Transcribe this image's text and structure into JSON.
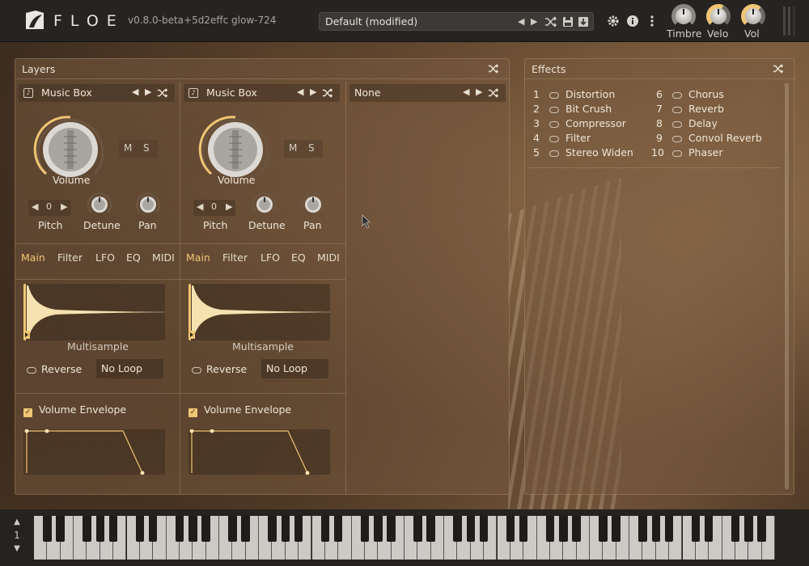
{
  "app": {
    "name": "FLOE",
    "version": "v0.8.0-beta+5d2effc  glow-724"
  },
  "preset": {
    "name": "Default (modified)"
  },
  "top_knobs": [
    {
      "label": "Timbre",
      "value": 0.5
    },
    {
      "label": "Velo",
      "value": 0.55
    },
    {
      "label": "Vol",
      "value": 0.6
    }
  ],
  "layers_panel": {
    "title": "Layers"
  },
  "layers": [
    {
      "instrument": "Music Box",
      "volume_label": "Volume",
      "mute": "M",
      "solo": "S",
      "pitch_value": "0",
      "pitch_label": "Pitch",
      "detune_label": "Detune",
      "pan_label": "Pan",
      "tabs": [
        "Main",
        "Filter",
        "LFO",
        "EQ",
        "MIDI"
      ],
      "active_tab": "Main",
      "sample_label": "Multisample",
      "reverse_label": "Reverse",
      "loop_mode": "No Loop",
      "envelope_label": "Volume Envelope"
    },
    {
      "instrument": "Music Box",
      "volume_label": "Volume",
      "mute": "M",
      "solo": "S",
      "pitch_value": "0",
      "pitch_label": "Pitch",
      "detune_label": "Detune",
      "pan_label": "Pan",
      "tabs": [
        "Main",
        "Filter",
        "LFO",
        "EQ",
        "MIDI"
      ],
      "active_tab": "Main",
      "sample_label": "Multisample",
      "reverse_label": "Reverse",
      "loop_mode": "No Loop",
      "envelope_label": "Volume Envelope"
    },
    {
      "instrument": "None"
    }
  ],
  "effects_panel": {
    "title": "Effects"
  },
  "effects": [
    {
      "n": "1",
      "name": "Distortion"
    },
    {
      "n": "2",
      "name": "Bit Crush"
    },
    {
      "n": "3",
      "name": "Compressor"
    },
    {
      "n": "4",
      "name": "Filter"
    },
    {
      "n": "5",
      "name": "Stereo Widen"
    },
    {
      "n": "6",
      "name": "Chorus"
    },
    {
      "n": "7",
      "name": "Reverb"
    },
    {
      "n": "8",
      "name": "Delay"
    },
    {
      "n": "9",
      "name": "Convol Reverb"
    },
    {
      "n": "10",
      "name": "Phaser"
    }
  ],
  "keyboard": {
    "octave": "1"
  },
  "icons": {
    "prev": "triangle-left-icon",
    "next": "triangle-right-icon",
    "shuffle": "shuffle-icon",
    "save": "save-icon",
    "import": "import-icon",
    "settings": "gear-icon",
    "info": "info-icon",
    "menu": "kebab-menu-icon"
  },
  "colors": {
    "accent": "#f0c674",
    "topbar": "#262321",
    "panel": "#765a40"
  }
}
